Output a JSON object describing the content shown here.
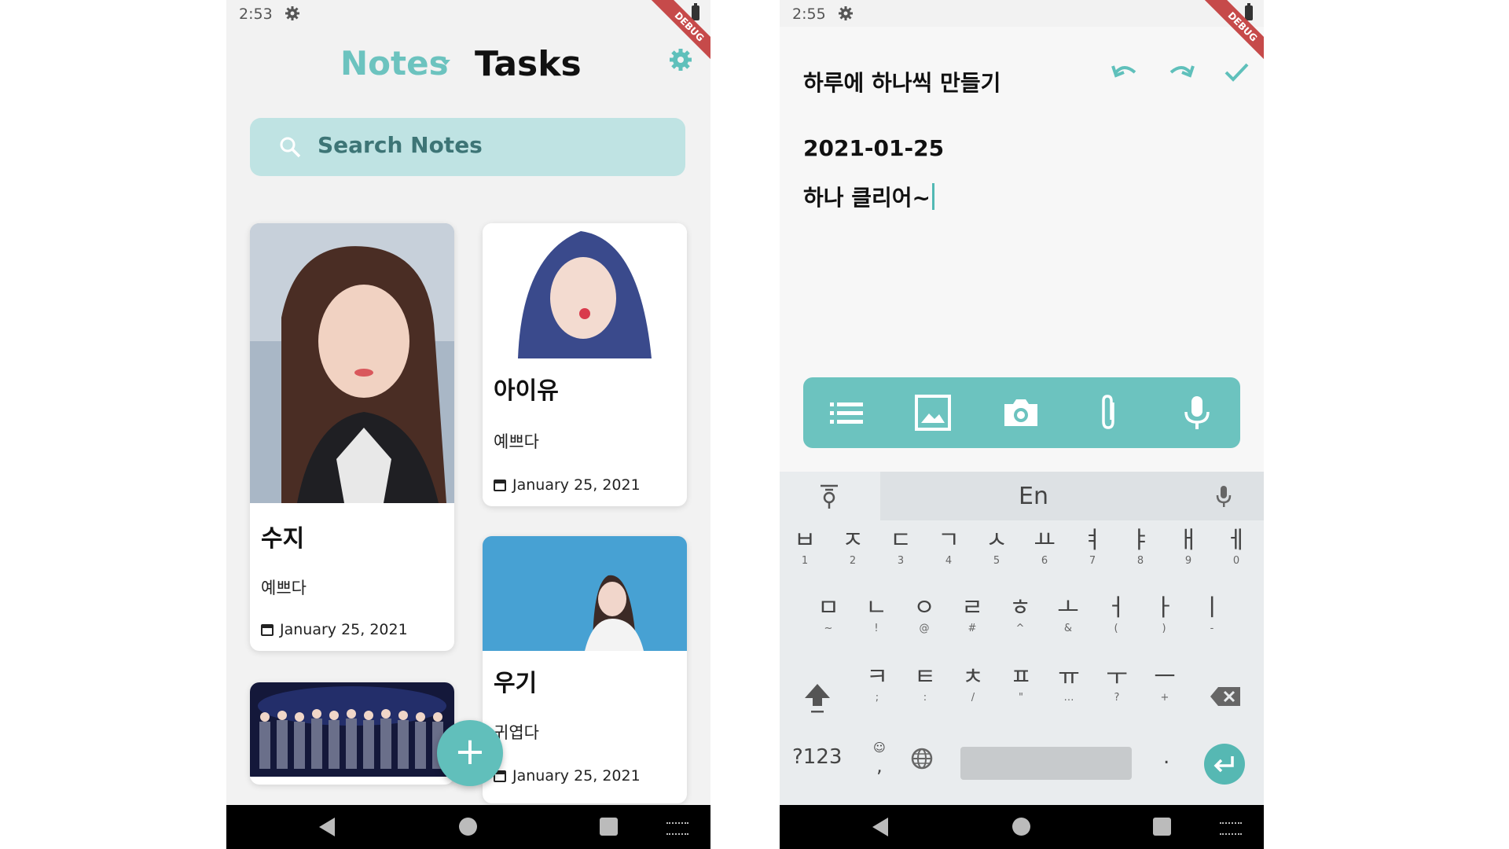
{
  "left": {
    "status": {
      "time": "2:53"
    },
    "debug_banner": "DEBUG",
    "tabs": {
      "notes": "Notes",
      "tasks": "Tasks"
    },
    "search": {
      "placeholder": "Search Notes"
    },
    "cards": [
      {
        "title": "수지",
        "body": "예쁘다",
        "date": "January 25, 2021"
      },
      {
        "title": "아이유",
        "body": "예쁘다",
        "date": "January 25, 2021"
      },
      {
        "title": "우기",
        "body": "귀엽다",
        "date": "January 25, 2021"
      }
    ],
    "fab": "+"
  },
  "right": {
    "status": {
      "time": "2:55"
    },
    "debug_banner": "DEBUG",
    "editor": {
      "title": "하루에 하나씩 만들기",
      "date": "2021-01-25",
      "text": "하나 클리어~"
    },
    "keyboard": {
      "lang": "En",
      "row1": [
        [
          "ㅂ",
          "1"
        ],
        [
          "ㅈ",
          "2"
        ],
        [
          "ㄷ",
          "3"
        ],
        [
          "ㄱ",
          "4"
        ],
        [
          "ㅅ",
          "5"
        ],
        [
          "ㅛ",
          "6"
        ],
        [
          "ㅕ",
          "7"
        ],
        [
          "ㅑ",
          "8"
        ],
        [
          "ㅐ",
          "9"
        ],
        [
          "ㅔ",
          "0"
        ]
      ],
      "row2": [
        [
          "ㅁ",
          "~"
        ],
        [
          "ㄴ",
          "!"
        ],
        [
          "ㅇ",
          "@"
        ],
        [
          "ㄹ",
          "#"
        ],
        [
          "ㅎ",
          "^"
        ],
        [
          "ㅗ",
          "&"
        ],
        [
          "ㅓ",
          "("
        ],
        [
          "ㅏ",
          ")"
        ],
        [
          "ㅣ",
          "-"
        ]
      ],
      "row3": [
        [
          "ㅋ",
          ";"
        ],
        [
          "ㅌ",
          ":"
        ],
        [
          "ㅊ",
          "/"
        ],
        [
          "ㅍ",
          "\""
        ],
        [
          "ㅠ",
          "…"
        ],
        [
          "ㅜ",
          "?"
        ],
        [
          "ㅡ",
          "+"
        ]
      ],
      "sym_key": "?123",
      "comma": ",",
      "period": "."
    }
  }
}
